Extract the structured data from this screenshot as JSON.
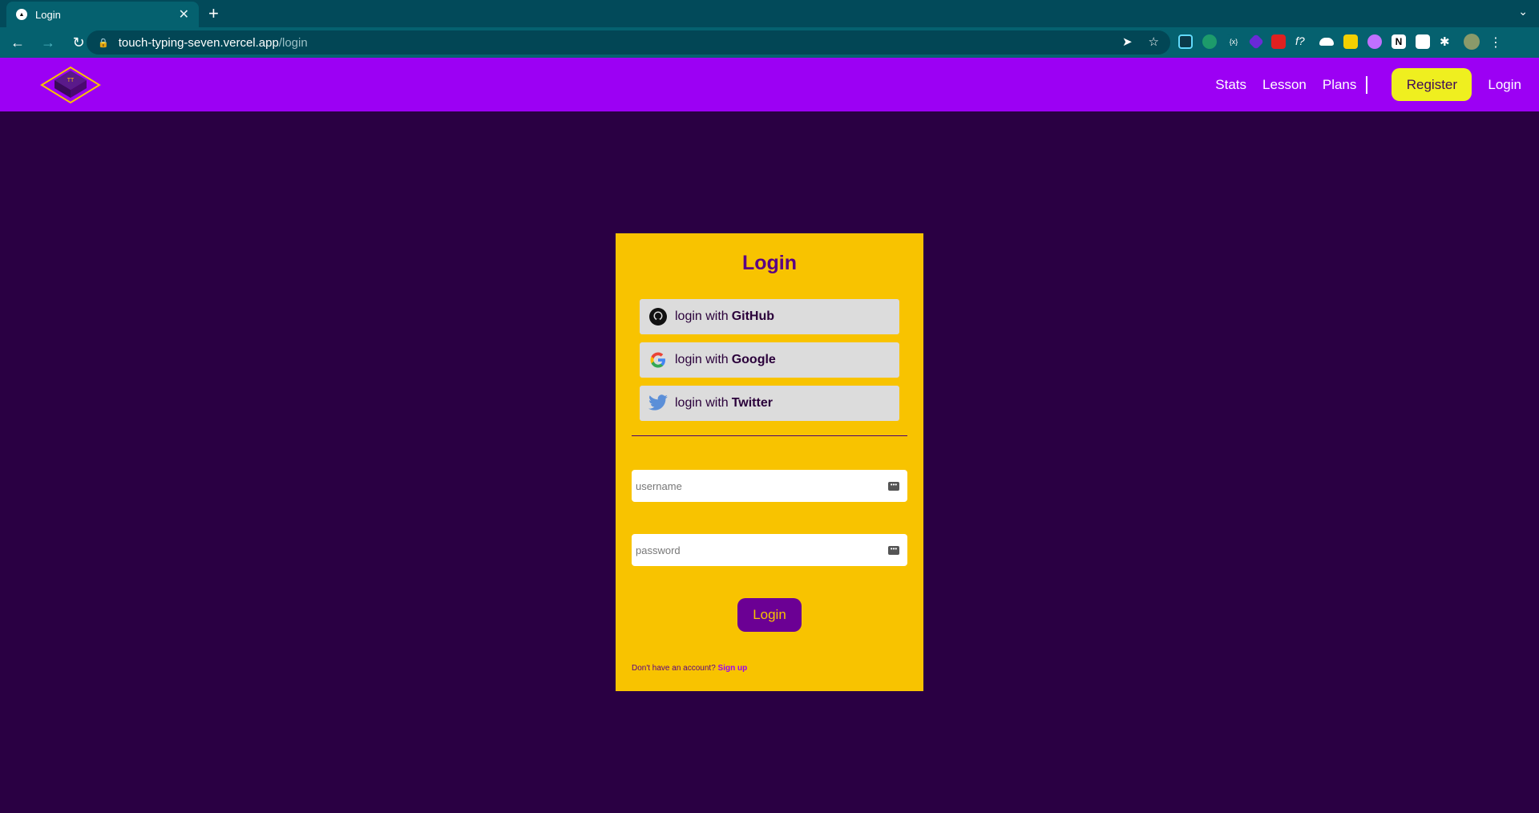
{
  "browser": {
    "tab_title": "Login",
    "new_tab_symbol": "+",
    "url_host": "touch-typing-seven.vercel.app",
    "url_path": "/login"
  },
  "header": {
    "nav": [
      "Stats",
      "Lesson",
      "Plans"
    ],
    "register_label": "Register",
    "login_label": "Login"
  },
  "card": {
    "title": "Login",
    "social": [
      {
        "prefix": "login with",
        "provider": "GitHub",
        "icon": "github-icon"
      },
      {
        "prefix": "login with",
        "provider": "Google",
        "icon": "google-icon"
      },
      {
        "prefix": "login with",
        "provider": "Twitter",
        "icon": "twitter-icon"
      }
    ],
    "username_placeholder": "username",
    "password_placeholder": "password",
    "submit_label": "Login",
    "signup_prompt": "Don't have an account?",
    "signup_link": "Sign up"
  },
  "colors": {
    "header_bg": "#9c00f4",
    "page_bg": "#2a0043",
    "card_bg": "#f8c300",
    "accent_button": "#6b0094",
    "register_bg": "#efef1f"
  }
}
